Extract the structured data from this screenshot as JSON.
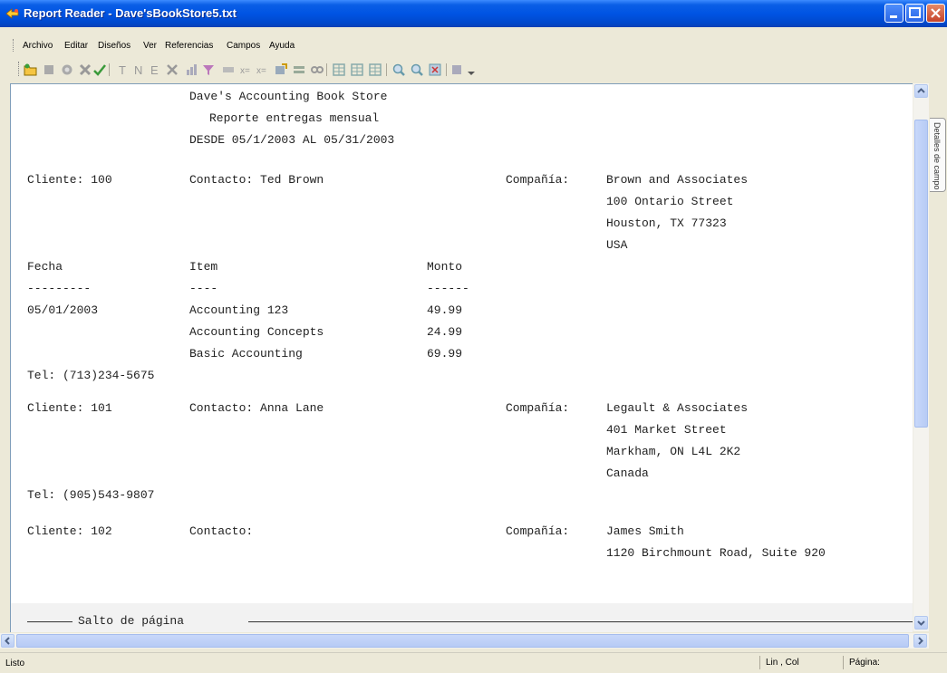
{
  "window": {
    "title": "Report Reader - Dave'sBookStore5.txt"
  },
  "menu": {
    "items": [
      "Archivo",
      "Editar",
      "Diseños",
      "Ver",
      "Referencias",
      "Campos",
      "Ayuda"
    ]
  },
  "toolbar": {
    "icons": [
      "open-icon",
      "stop-icon",
      "record-icon",
      "delete-icon",
      "check-icon",
      "text-field-icon",
      "number-field-icon",
      "expression-field-icon",
      "cancel-field-icon",
      "chart-icon",
      "filter-icon",
      "highlight-icon",
      "formula-icon",
      "sum-icon",
      "wizard-icon",
      "stack-icon",
      "link-icon",
      "table-icon",
      "table-alt-icon",
      "table-grid-icon",
      "zoom-in-icon",
      "zoom-out-icon",
      "fit-icon",
      "view-icon",
      "more-icon"
    ]
  },
  "document": {
    "header": {
      "line1": "Dave's Accounting Book Store",
      "line2": "Reporte entregas mensual",
      "line3": "DESDE 05/1/2003 AL 05/31/2003"
    },
    "customers": [
      {
        "cliente": "Cliente: 100",
        "contacto": "Contacto: Ted Brown",
        "compania_label": "Compañía:",
        "address": [
          "Brown and Associates",
          "100 Ontario Street",
          "Houston, TX 77323",
          "USA"
        ],
        "tel": "Tel: (713)234-5675"
      },
      {
        "cliente": "Cliente: 101",
        "contacto": "Contacto: Anna Lane",
        "compania_label": "Compañía:",
        "address": [
          "Legault & Associates",
          "401 Market Street",
          "Markham, ON L4L 2K2",
          "Canada"
        ],
        "tel": "Tel: (905)543-9807"
      },
      {
        "cliente": "Cliente: 102",
        "contacto": "Contacto:",
        "compania_label": "Compañía:",
        "address": [
          "James Smith",
          "1120 Birchmount Road, Suite 920"
        ]
      }
    ],
    "table": {
      "headers": {
        "fecha": "Fecha",
        "item": "Item",
        "monto": "Monto"
      },
      "underlines": {
        "fecha": "---------",
        "item": "----",
        "monto": "------"
      },
      "date": "05/01/2003",
      "rows": [
        {
          "item": "Accounting 123",
          "monto": "49.99"
        },
        {
          "item": "Accounting Concepts",
          "monto": "24.99"
        },
        {
          "item": "Basic Accounting",
          "monto": "69.99"
        }
      ]
    },
    "page_break_label": "Salto de página"
  },
  "side_tab": {
    "label": "Detalles de campo"
  },
  "status": {
    "text": "Listo",
    "position": "Lin , Col",
    "page": "Página:"
  },
  "colors": {
    "titlebar": "#0054e3",
    "chrome": "#ece9d8",
    "scroll_thumb": "#c1d3fb"
  }
}
